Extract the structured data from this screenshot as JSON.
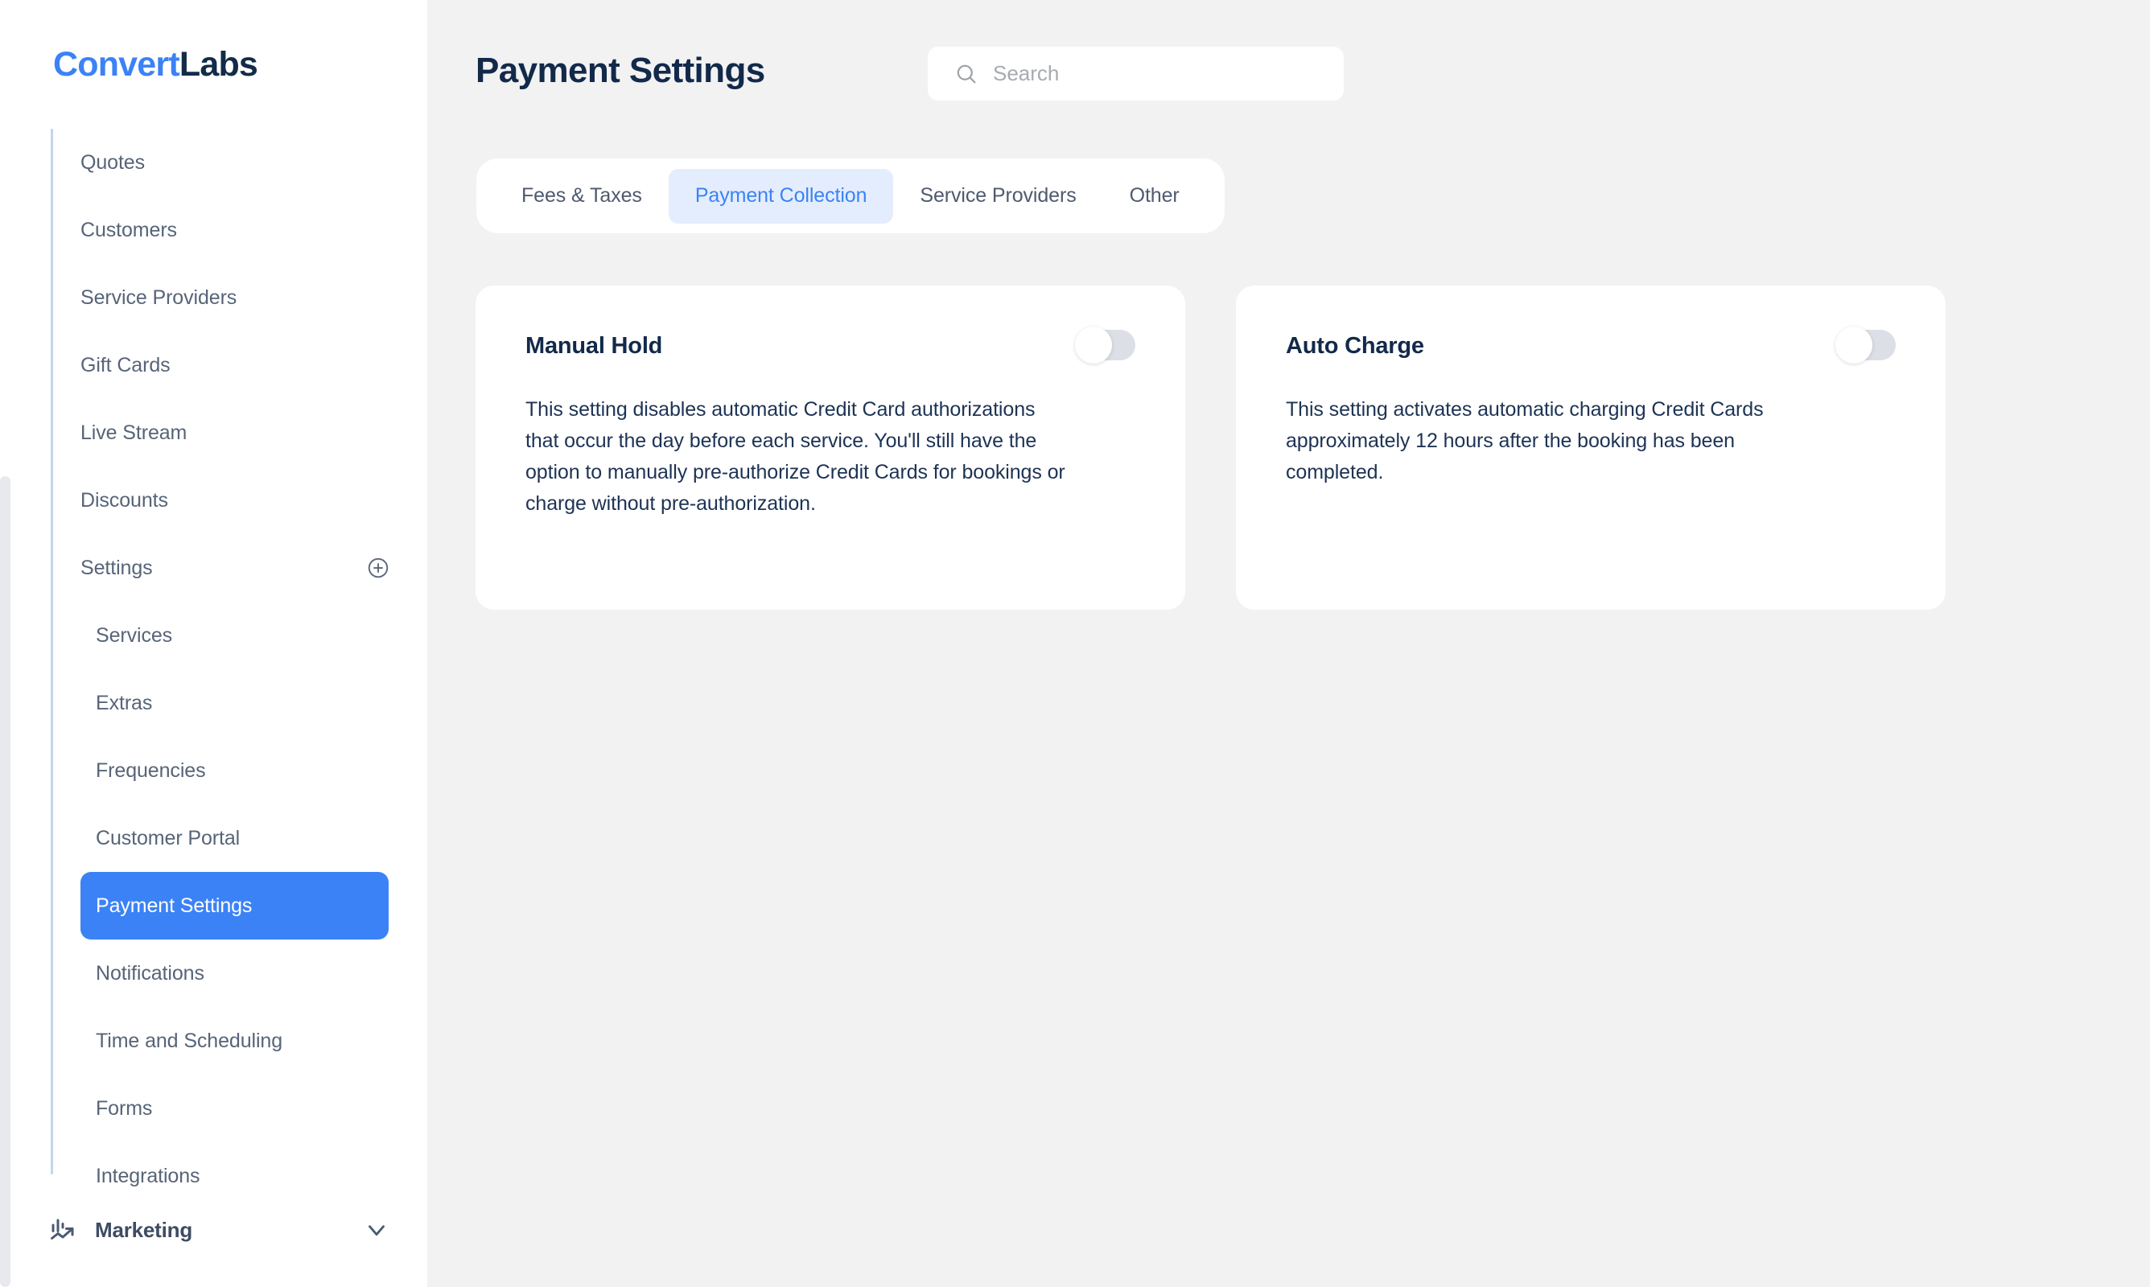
{
  "brand": {
    "name_part_a": "Convert",
    "name_part_b": "Labs",
    "accent_color": "#3b82f6",
    "dark_color": "#12294a"
  },
  "sidebar": {
    "items": [
      {
        "label": "Quotes",
        "level": "top",
        "active": false,
        "trailing_icon": null
      },
      {
        "label": "Customers",
        "level": "top",
        "active": false,
        "trailing_icon": null
      },
      {
        "label": "Service Providers",
        "level": "top",
        "active": false,
        "trailing_icon": null
      },
      {
        "label": "Gift Cards",
        "level": "top",
        "active": false,
        "trailing_icon": null
      },
      {
        "label": "Live Stream",
        "level": "top",
        "active": false,
        "trailing_icon": null
      },
      {
        "label": "Discounts",
        "level": "top",
        "active": false,
        "trailing_icon": null
      },
      {
        "label": "Settings",
        "level": "top",
        "active": false,
        "trailing_icon": "plus-circle-icon"
      },
      {
        "label": "Services",
        "level": "sub",
        "active": false,
        "trailing_icon": null
      },
      {
        "label": "Extras",
        "level": "sub",
        "active": false,
        "trailing_icon": null
      },
      {
        "label": "Frequencies",
        "level": "sub",
        "active": false,
        "trailing_icon": null
      },
      {
        "label": "Customer Portal",
        "level": "sub",
        "active": false,
        "trailing_icon": null
      },
      {
        "label": "Payment Settings",
        "level": "sub",
        "active": true,
        "trailing_icon": null
      },
      {
        "label": "Notifications",
        "level": "sub",
        "active": false,
        "trailing_icon": null
      },
      {
        "label": "Time and Scheduling",
        "level": "sub",
        "active": false,
        "trailing_icon": null
      },
      {
        "label": "Forms",
        "level": "sub",
        "active": false,
        "trailing_icon": null
      },
      {
        "label": "Integrations",
        "level": "sub",
        "active": false,
        "trailing_icon": null
      }
    ],
    "footer": {
      "label": "Marketing",
      "icon": "analytics-growth-icon",
      "chevron": "chevron-down-icon"
    }
  },
  "header": {
    "title": "Payment Settings",
    "search": {
      "placeholder": "Search",
      "value": "",
      "icon": "search-icon"
    }
  },
  "tabs": [
    {
      "label": "Fees & Taxes",
      "active": false
    },
    {
      "label": "Payment Collection",
      "active": true
    },
    {
      "label": "Service Providers",
      "active": false
    },
    {
      "label": "Other",
      "active": false
    }
  ],
  "cards": [
    {
      "title": "Manual Hold",
      "description": "This setting disables automatic Credit Card authorizations that occur the day before each service. You'll still have the option to manually pre-authorize Credit Cards for bookings or charge without pre-authorization.",
      "toggle_state": "off"
    },
    {
      "title": "Auto Charge",
      "description": "This setting activates automatic charging Credit Cards approximately 12 hours after the booking has been completed.",
      "toggle_state": "off"
    }
  ]
}
